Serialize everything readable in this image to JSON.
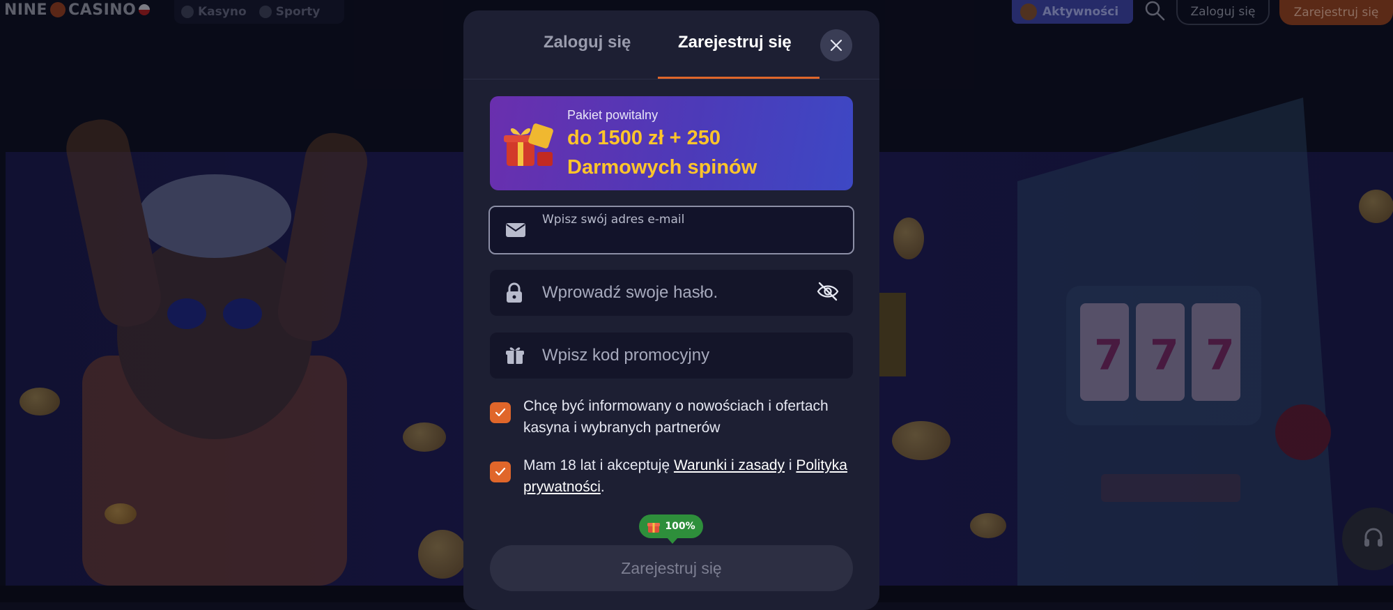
{
  "header": {
    "logo_text_left": "NINE",
    "logo_text_right": "CASINO",
    "nav": [
      {
        "label": "Kasyno",
        "icon": "cherries-icon"
      },
      {
        "label": "Sporty",
        "icon": "soccer-ball-icon"
      }
    ],
    "activity_label": "Aktywności",
    "login_label": "Zaloguj się",
    "register_label": "Zarejestruj się"
  },
  "modal": {
    "tabs": {
      "login": "Zaloguj się",
      "register": "Zarejestruj się",
      "active": "register"
    },
    "promo": {
      "label": "Pakiet powitalny",
      "line1": "do 1500 zł + 250",
      "line2": "Darmowych spinów"
    },
    "email": {
      "label": "Wpisz swój adres e-mail",
      "value": ""
    },
    "password": {
      "placeholder": "Wprowadź swoje hasło."
    },
    "promo_code": {
      "placeholder": "Wpisz kod promocyjny"
    },
    "consent_news": {
      "checked": true,
      "text": "Chcę być informowany o nowościach i ofertach kasyna i wybranych partnerów"
    },
    "consent_age": {
      "checked": true,
      "text_before": "Mam 18 lat i akceptuję ",
      "terms_link": "Warunki i zasady",
      "text_middle": " i ",
      "privacy_link": "Polityka prywatności",
      "text_after": "."
    },
    "progress": {
      "value": "100%"
    },
    "submit_label": "Zarejestruj się"
  },
  "colors": {
    "accent": "#e0662a",
    "promo_text": "#ffc52a",
    "modal_bg": "#1d1f33",
    "progress_green": "#2e8f3b"
  }
}
